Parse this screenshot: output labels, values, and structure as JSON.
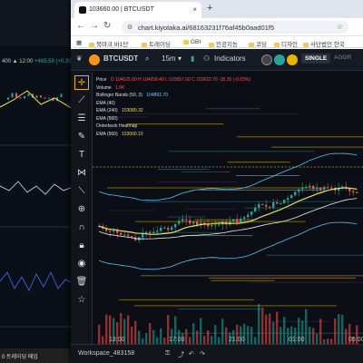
{
  "background_window": {
    "price_line": "400 ▲ 12:00",
    "price_change": "+465.56 (+0.39%)",
    "taskbar_items": [
      "0 ",
      "트레이딩 매입"
    ]
  },
  "browser": {
    "tab_title": "103660.00 | BTCUSDT",
    "url": "chart.kiyotaka.ai/68163231f76af45b0aad01f5",
    "bookmarks": [
      "북마크 바1단",
      "트레이딩",
      "GBI",
      "인공지능",
      "코딩",
      "디자인",
      "사단법인 한국"
    ]
  },
  "app": {
    "symbol": "BTCUSDT",
    "timeframe": "15m",
    "indicators_label": "Indicators",
    "single_label": "SINGLE",
    "legend": [
      {
        "label": "Price",
        "value": "O 104625.60 H 104658.40 L 103657.00 C 103622.70 -35.30 (-0.03%)",
        "color": "#ff5252"
      },
      {
        "label": "Volume",
        "value": "1.6K",
        "color": "#ff5252"
      },
      {
        "label": "Bollinger Bands (50, 3)",
        "value": "104891.70",
        "color": "#7ec8ff"
      },
      {
        "label": "EMA (40)",
        "value": "",
        "color": "#ffffff"
      },
      {
        "label": "EMA (240)",
        "value": "103080.32",
        "color": "#ffd740"
      },
      {
        "label": "EMA (560)",
        "value": "",
        "color": "#ffffff"
      },
      {
        "label": "Orderbook Heatmap",
        "value": "",
        "color": "#ffffff"
      },
      {
        "label": "EMA (560)",
        "value": "103000.10",
        "color": "#ffd740"
      }
    ],
    "time_labels": [
      "13:00",
      "17:00",
      "21:00",
      "01:00",
      "05:00"
    ],
    "workspace": "Workspace_483158",
    "tools": [
      "crosshair-icon",
      "trend-line-icon",
      "fib-icon",
      "brush-icon",
      "text-icon",
      "pattern-icon",
      "ruler-icon",
      "zoom-icon",
      "magnet-icon",
      "lock-icon",
      "eye-icon",
      "trash-icon",
      "star-icon"
    ],
    "colors": {
      "up": "#26a69a",
      "down": "#ef5350",
      "ema_yellow": "#e8e05a",
      "bb": "#4fc3f7"
    }
  }
}
